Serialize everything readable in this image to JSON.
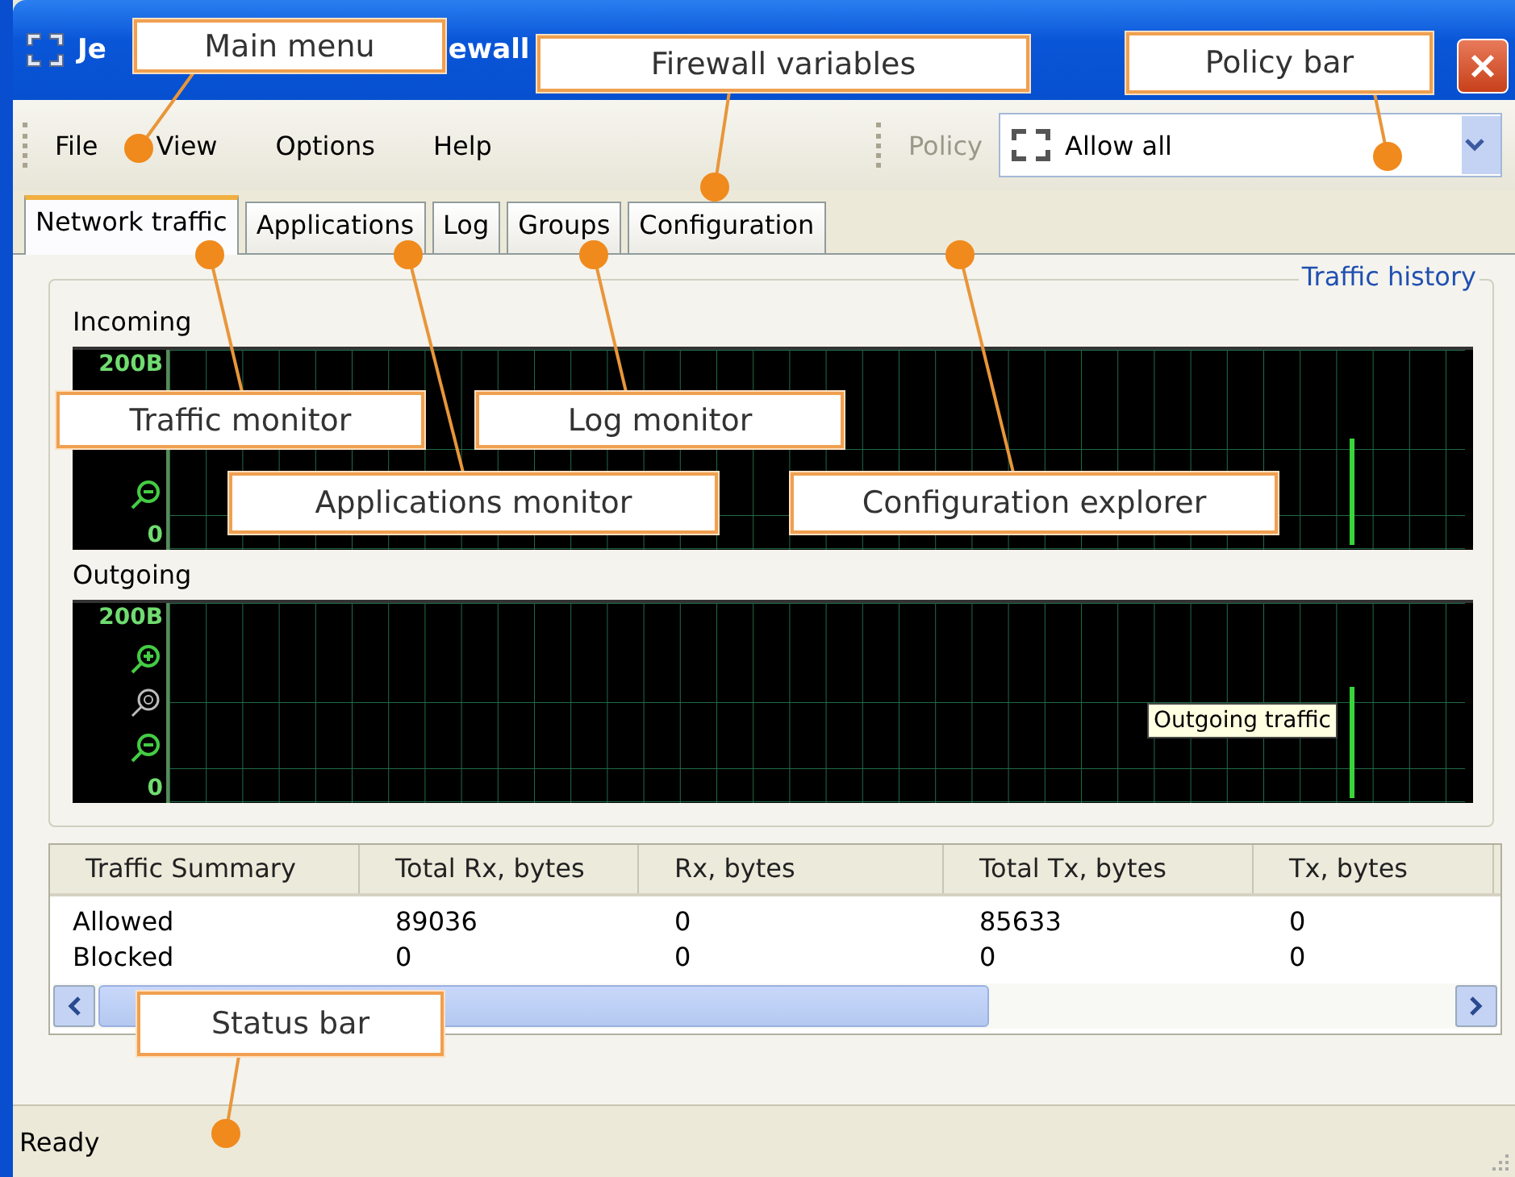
{
  "window": {
    "title_parts": [
      "Je",
      "ewall"
    ]
  },
  "menu": [
    "File",
    "View",
    "Options",
    "Help"
  ],
  "policy": {
    "label": "Policy",
    "value": "Allow all"
  },
  "tabs": [
    {
      "label": "Network traffic",
      "selected": true
    },
    {
      "label": "Applications",
      "selected": false
    },
    {
      "label": "Log",
      "selected": false
    },
    {
      "label": "Groups",
      "selected": false
    },
    {
      "label": "Configuration",
      "selected": false
    }
  ],
  "history_link": "Traffic history",
  "graphs": [
    {
      "label": "Incoming",
      "max": "200B",
      "min": "0"
    },
    {
      "label": "Outgoing",
      "max": "200B",
      "min": "0",
      "tooltip": "Outgoing traffic"
    }
  ],
  "table": {
    "columns": [
      "Traffic Summary",
      "Total Rx, bytes",
      "Rx, bytes",
      "Total Tx, bytes",
      "Tx, bytes"
    ],
    "rows": [
      [
        "Allowed",
        "89036",
        "0",
        "85633",
        "0"
      ],
      [
        "Blocked",
        "0",
        "0",
        "0",
        "0"
      ]
    ]
  },
  "status_bar": "Ready",
  "callouts": [
    {
      "label": "Main menu"
    },
    {
      "label": "Firewall variables"
    },
    {
      "label": "Policy bar"
    },
    {
      "label": "Traffic monitor"
    },
    {
      "label": "Log monitor"
    },
    {
      "label": "Applications monitor"
    },
    {
      "label": "Configuration explorer"
    },
    {
      "label": "Status bar"
    }
  ]
}
